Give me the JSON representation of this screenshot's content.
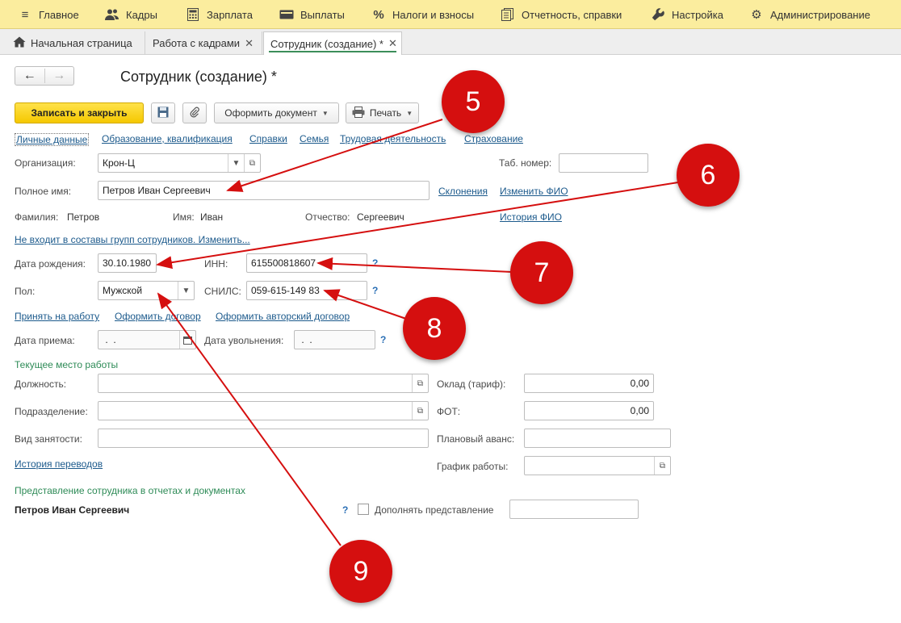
{
  "topmenu": {
    "items": [
      {
        "label": "Главное",
        "icon": "hamburger-menu-icon"
      },
      {
        "label": "Кадры",
        "icon": "people-icon"
      },
      {
        "label": "Зарплата",
        "icon": "calculator-icon"
      },
      {
        "label": "Выплаты",
        "icon": "wallet-icon"
      },
      {
        "label": "Налоги и взносы",
        "icon": "percent-icon"
      },
      {
        "label": "Отчетность, справки",
        "icon": "reports-icon"
      },
      {
        "label": "Настройка",
        "icon": "wrench-icon"
      },
      {
        "label": "Администрирование",
        "icon": "gear-icon"
      }
    ]
  },
  "tabs": [
    {
      "label": "Начальная страница",
      "icon": "home-icon"
    },
    {
      "label": "Работа с кадрами",
      "close": "✕"
    },
    {
      "label": "Сотрудник (создание) *",
      "close": "✕",
      "active": true
    }
  ],
  "form": {
    "title": "Сотрудник (создание) *",
    "toolbar": {
      "save_close": "Записать и закрыть",
      "make_document": "Оформить документ",
      "print": "Печать"
    },
    "sections_links": [
      "Личные данные",
      "Образование, квалификация",
      "Справки",
      "Семья",
      "Трудовая деятельность",
      "Страхование"
    ],
    "organization": {
      "label": "Организация:",
      "value": "Крон-Ц"
    },
    "tab_number": {
      "label": "Таб. номер:",
      "value": ""
    },
    "full_name": {
      "label": "Полное имя:",
      "value": "Петров Иван Сергеевич"
    },
    "declensions_link": "Склонения",
    "change_name_link": "Изменить ФИО",
    "name_history_link": "История ФИО",
    "surname": {
      "label": "Фамилия:",
      "value": "Петров"
    },
    "first_name": {
      "label": "Имя:",
      "value": "Иван"
    },
    "patronymic": {
      "label": "Отчество:",
      "value": "Сергеевич"
    },
    "groups_link": "Не входит в составы групп сотрудников. Изменить...",
    "birth_date": {
      "label": "Дата рождения:",
      "value": "30.10.1980"
    },
    "inn": {
      "label": "ИНН:",
      "value": "615500818607"
    },
    "gender": {
      "label": "Пол:",
      "value": "Мужской"
    },
    "snils": {
      "label": "СНИЛС:",
      "value": "059-615-149 83"
    },
    "hire_link": "Принять на работу",
    "contract_link": "Оформить договор",
    "author_contract_link": "Оформить авторский договор",
    "hire_date": {
      "label": "Дата приема:",
      "value": " .  ."
    },
    "dismissal_date": {
      "label": "Дата увольнения:",
      "value": " .  ."
    },
    "current_work_section": "Текущее место работы",
    "position": {
      "label": "Должность:",
      "value": ""
    },
    "salary": {
      "label": "Оклад (тариф):",
      "value": "0,00"
    },
    "department": {
      "label": "Подразделение:",
      "value": ""
    },
    "fot": {
      "label": "ФОТ:",
      "value": "0,00"
    },
    "employment_type": {
      "label": "Вид занятости:",
      "value": ""
    },
    "planned_advance": {
      "label": "Плановый аванс:",
      "value": ""
    },
    "transfers_history_link": "История переводов",
    "work_schedule": {
      "label": "График работы:",
      "value": ""
    },
    "representation_section": "Представление сотрудника в отчетах и документах",
    "representation_name": "Петров Иван Сергеевич",
    "supplement_checkbox": {
      "label": "Дополнять представление",
      "checked": false
    },
    "supplement_value": "",
    "help_mark": "?"
  },
  "annotations": {
    "markers": [
      "5",
      "6",
      "7",
      "8",
      "9"
    ],
    "color": "#d50f0f"
  }
}
